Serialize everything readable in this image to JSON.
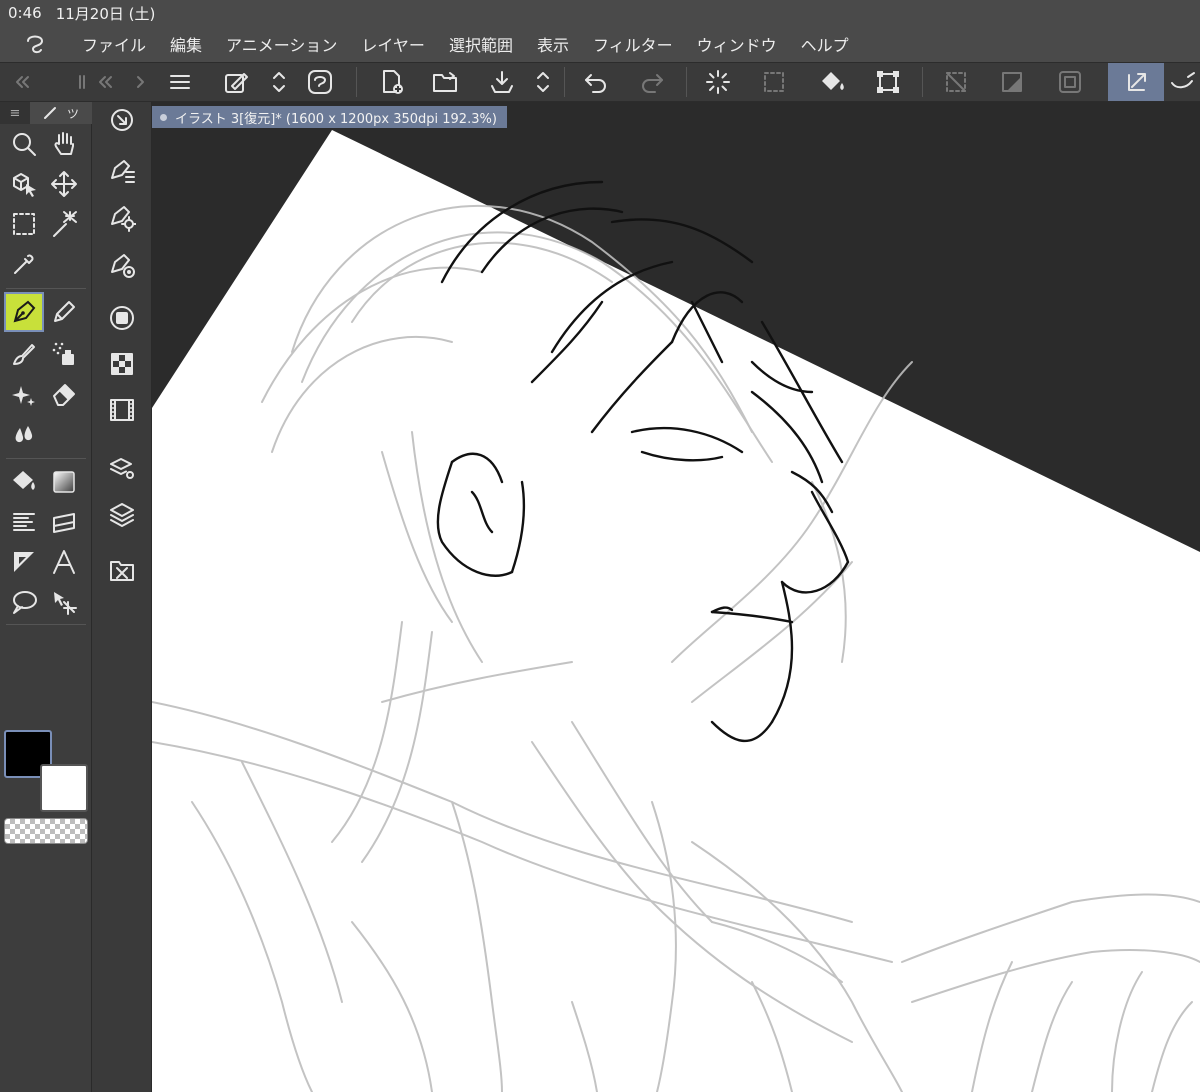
{
  "status": {
    "time": "0:46",
    "date": "11月20日 (土)"
  },
  "menu": {
    "items": [
      "ファイル",
      "編集",
      "アニメーション",
      "レイヤー",
      "選択範囲",
      "表示",
      "フィルター",
      "ウィンドウ",
      "ヘルプ"
    ]
  },
  "panel_tabs": {
    "menu_glyph": "≡",
    "tool_tab_label": "ツ"
  },
  "document": {
    "tab_title": "イラスト 3[復元]* (1600 x 1200px 350dpi 192.3%)"
  },
  "colors": {
    "main_color": "#000000",
    "sub_color": "#ffffff",
    "accent": "#6b7a97",
    "selected_tool": "#c8e03a"
  },
  "selected_tool": "pen-tool",
  "icons": {
    "toolbar": [
      "menu-icon",
      "transform-pen-icon",
      "up-down-icon",
      "app-icon",
      "new-canvas-icon",
      "open-folder-icon",
      "save-icon",
      "up-down-icon",
      "undo-icon",
      "redo-icon",
      "loading-icon",
      "select-all-icon",
      "fill-icon",
      "transform-icon",
      "deselect-icon",
      "invert-selection-icon",
      "selection-border-icon",
      "selection-tool-icon",
      "extra-icon"
    ],
    "tools": [
      "zoom-icon",
      "hand-icon",
      "object-icon",
      "move-icon",
      "selection-rect-icon",
      "auto-select-icon",
      "eyedropper-icon",
      "pen-icon",
      "pencil-icon",
      "brush-icon",
      "airbrush-icon",
      "decoration-icon",
      "eraser-icon",
      "blend-icon",
      "fill-icon",
      "gradient-icon",
      "speedlines-icon",
      "frame-border-icon",
      "ruler-icon",
      "text-icon",
      "balloon-icon",
      "correct-line-icon"
    ]
  }
}
